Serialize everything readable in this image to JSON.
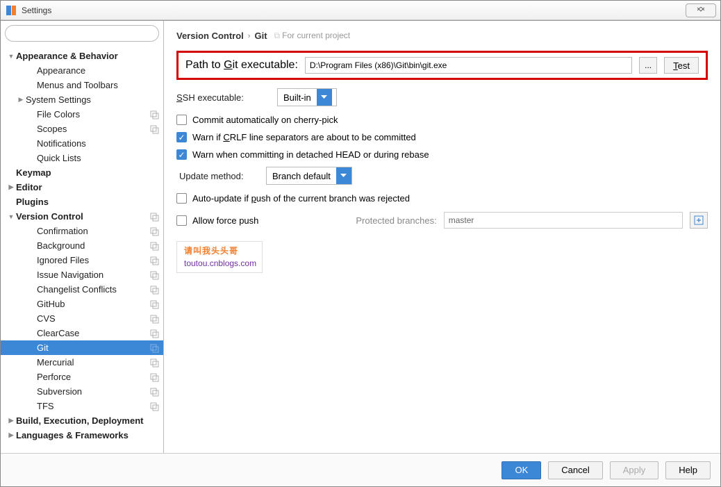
{
  "window": {
    "title": "Settings"
  },
  "breadcrumb": {
    "parent": "Version Control",
    "current": "Git",
    "hint": "For current project"
  },
  "form": {
    "path_label_pre": "Path to ",
    "path_label_u": "G",
    "path_label_post": "it executable:",
    "path_value": "D:\\Program Files (x86)\\Git\\bin\\git.exe",
    "test_label": "Test",
    "ssh_label_u": "S",
    "ssh_label_post": "SH executable:",
    "ssh_value": "Built-in",
    "cb_commit": "Commit automatically on cherry-pick",
    "cb_crlf_pre": "Warn if ",
    "cb_crlf_u": "C",
    "cb_crlf_post": "RLF line separators are about to be committed",
    "cb_detached": "Warn when committing in detached HEAD or during rebase",
    "update_label": "Update method:",
    "update_value": "Branch default",
    "cb_autoupdate_pre": "Auto-update if ",
    "cb_autoupdate_u": "p",
    "cb_autoupdate_post": "ush of the current branch was rejected",
    "cb_force": "Allow force push",
    "protected_label": "Protected branches:",
    "protected_value": "master"
  },
  "watermark": {
    "line1": "请叫我头头哥",
    "line2": "toutou.cnblogs.com"
  },
  "footer": {
    "ok": "OK",
    "cancel": "Cancel",
    "apply": "Apply",
    "help": "Help"
  },
  "tree": [
    {
      "label": "Appearance & Behavior",
      "indent": 0,
      "bold": true,
      "arrow": "down"
    },
    {
      "label": "Appearance",
      "indent": 2
    },
    {
      "label": "Menus and Toolbars",
      "indent": 2
    },
    {
      "label": "System Settings",
      "indent": 1,
      "arrow": "right"
    },
    {
      "label": "File Colors",
      "indent": 2,
      "copy": true
    },
    {
      "label": "Scopes",
      "indent": 2,
      "copy": true
    },
    {
      "label": "Notifications",
      "indent": 2
    },
    {
      "label": "Quick Lists",
      "indent": 2
    },
    {
      "label": "Keymap",
      "indent": 0,
      "bold": true
    },
    {
      "label": "Editor",
      "indent": 0,
      "bold": true,
      "arrow": "right"
    },
    {
      "label": "Plugins",
      "indent": 0,
      "bold": true
    },
    {
      "label": "Version Control",
      "indent": 0,
      "bold": true,
      "arrow": "down",
      "copy": true
    },
    {
      "label": "Confirmation",
      "indent": 2,
      "copy": true
    },
    {
      "label": "Background",
      "indent": 2,
      "copy": true
    },
    {
      "label": "Ignored Files",
      "indent": 2,
      "copy": true
    },
    {
      "label": "Issue Navigation",
      "indent": 2,
      "copy": true
    },
    {
      "label": "Changelist Conflicts",
      "indent": 2,
      "copy": true
    },
    {
      "label": "GitHub",
      "indent": 2,
      "copy": true
    },
    {
      "label": "CVS",
      "indent": 2,
      "copy": true
    },
    {
      "label": "ClearCase",
      "indent": 2,
      "copy": true
    },
    {
      "label": "Git",
      "indent": 2,
      "copy": true,
      "selected": true
    },
    {
      "label": "Mercurial",
      "indent": 2,
      "copy": true
    },
    {
      "label": "Perforce",
      "indent": 2,
      "copy": true
    },
    {
      "label": "Subversion",
      "indent": 2,
      "copy": true
    },
    {
      "label": "TFS",
      "indent": 2,
      "copy": true
    },
    {
      "label": "Build, Execution, Deployment",
      "indent": 0,
      "bold": true,
      "arrow": "right"
    },
    {
      "label": "Languages & Frameworks",
      "indent": 0,
      "bold": true,
      "arrow": "right"
    }
  ]
}
